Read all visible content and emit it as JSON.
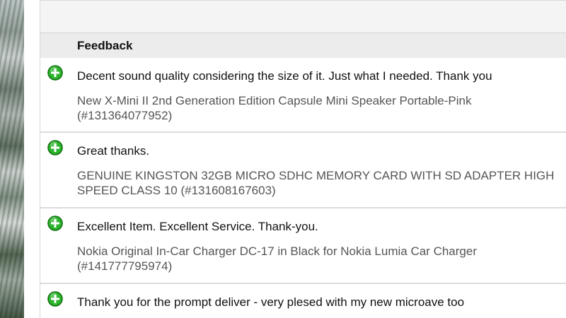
{
  "feedback": {
    "header_label": "Feedback",
    "rows": [
      {
        "comment": "Decent sound quality considering the size of it. Just what I needed. Thank you",
        "item_title": "New X-Mini II 2nd Generation Edition Capsule Mini Speaker Portable-Pink",
        "item_number": "(#131364077952)",
        "rating_icon": "positive-plus-icon"
      },
      {
        "comment": "Great thanks.",
        "item_title": "GENUINE KINGSTON 32GB MICRO SDHC MEMORY CARD WITH SD ADAPTER HIGH",
        "item_number": "SPEED CLASS 10 (#131608167603)",
        "rating_icon": "positive-plus-icon"
      },
      {
        "comment": "Excellent Item. Excellent Service. Thank-you.",
        "item_title": "Nokia Original In-Car Charger DC-17 in Black for Nokia Lumia Car Charger",
        "item_number": "(#141777795974)",
        "rating_icon": "positive-plus-icon"
      },
      {
        "comment": "Thank you for the prompt deliver - very plesed with my new microave too",
        "rating_icon": "positive-plus-icon"
      }
    ]
  },
  "colors": {
    "positive_green": "#2bb32b",
    "text_primary": "#111111",
    "text_secondary": "#555555"
  }
}
